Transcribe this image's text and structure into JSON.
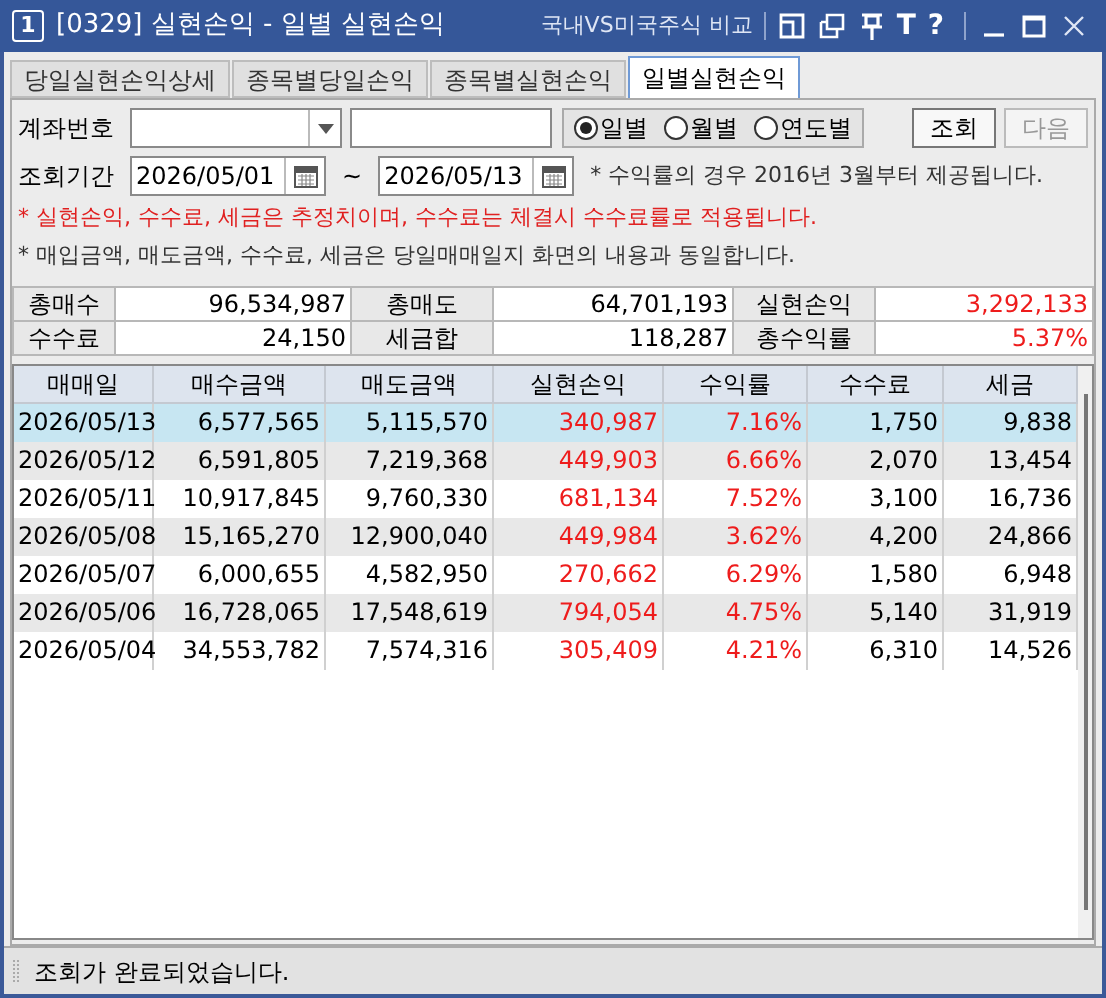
{
  "window": {
    "number": "1",
    "title": "[0329] 실현손익 - 일별 실현손익",
    "link": "국내VS미국주식 비교",
    "glyphs": [
      "T",
      "?"
    ]
  },
  "tabs": [
    {
      "label": "당일실현손익상세",
      "selected": false
    },
    {
      "label": "종목별당일손익",
      "selected": false
    },
    {
      "label": "종목별실현손익",
      "selected": false
    },
    {
      "label": "일별실현손익",
      "selected": true
    }
  ],
  "form": {
    "account_label": "계좌번호",
    "period_label": "조회기간",
    "start_date": "2026/05/01",
    "separator": "~",
    "end_date": "2026/05/13",
    "periods": [
      {
        "label": "일별",
        "selected": true
      },
      {
        "label": "월별",
        "selected": false
      },
      {
        "label": "연도별",
        "selected": false
      }
    ],
    "buttons": [
      {
        "label": "조회",
        "disabled": false
      },
      {
        "label": "다음",
        "disabled": true
      }
    ],
    "notes": [
      {
        "text": "* 수익률의 경우 2016년 3월부터 제공됩니다.",
        "kind": "plain"
      },
      {
        "text": "* 실현손익, 수수료, 세금은 추정치이며, 수수료는 체결시 수수료률로 적용됩니다.",
        "kind": "warning"
      },
      {
        "text": "* 매입금액, 매도금액, 수수료, 세금은 당일매매일지 화면의 내용과 동일합니다.",
        "kind": "plain"
      }
    ]
  },
  "summary": [
    {
      "label": "총매수",
      "value": "96,534,987",
      "kind": "plain"
    },
    {
      "label": "총매도",
      "value": "64,701,193",
      "kind": "plain"
    },
    {
      "label": "실현손익",
      "value": "3,292,133",
      "kind": "profit"
    },
    {
      "label": "수수료",
      "value": "24,150",
      "kind": "plain"
    },
    {
      "label": "세금합",
      "value": "118,287",
      "kind": "plain"
    },
    {
      "label": "총수익률",
      "value": "5.37%",
      "kind": "profit"
    }
  ],
  "table": {
    "columns": [
      {
        "label": "매매일",
        "kind": "date"
      },
      {
        "label": "매수금액",
        "kind": "plain"
      },
      {
        "label": "매도금액",
        "kind": "plain"
      },
      {
        "label": "실현손익",
        "kind": "profit"
      },
      {
        "label": "수익률",
        "kind": "profit"
      },
      {
        "label": "수수료",
        "kind": "plain"
      },
      {
        "label": "세금",
        "kind": "plain"
      }
    ],
    "rows": [
      {
        "selected": true,
        "cells": [
          "2026/05/13",
          "6,577,565",
          "5,115,570",
          "340,987",
          "7.16%",
          "1,750",
          "9,838"
        ]
      },
      {
        "selected": false,
        "cells": [
          "2026/05/12",
          "6,591,805",
          "7,219,368",
          "449,903",
          "6.66%",
          "2,070",
          "13,454"
        ]
      },
      {
        "selected": false,
        "cells": [
          "2026/05/11",
          "10,917,845",
          "9,760,330",
          "681,134",
          "7.52%",
          "3,100",
          "16,736"
        ]
      },
      {
        "selected": false,
        "cells": [
          "2026/05/08",
          "15,165,270",
          "12,900,040",
          "449,984",
          "3.62%",
          "4,200",
          "24,866"
        ]
      },
      {
        "selected": false,
        "cells": [
          "2026/05/07",
          "6,000,655",
          "4,582,950",
          "270,662",
          "6.29%",
          "1,580",
          "6,948"
        ]
      },
      {
        "selected": false,
        "cells": [
          "2026/05/06",
          "16,728,065",
          "17,548,619",
          "794,054",
          "4.75%",
          "5,140",
          "31,919"
        ]
      },
      {
        "selected": false,
        "cells": [
          "2026/05/04",
          "34,553,782",
          "7,574,316",
          "305,409",
          "4.21%",
          "6,310",
          "14,526"
        ]
      }
    ]
  },
  "status_bar": {
    "text": "조회가 완료되었습니다."
  }
}
